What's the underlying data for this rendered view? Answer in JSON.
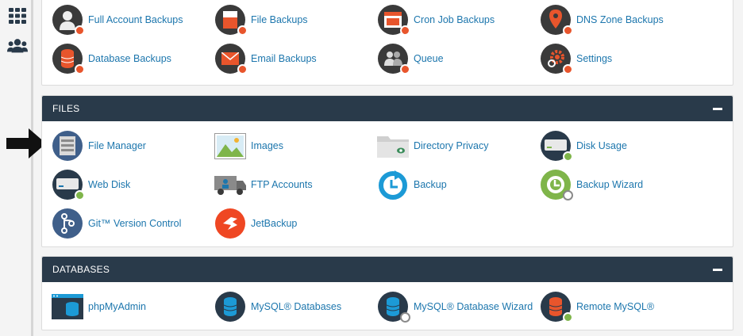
{
  "sidebar": {
    "icons": [
      "grid-icon",
      "users-icon"
    ]
  },
  "backups_panel": {
    "items": [
      {
        "label": "Full Account Backups",
        "icon": "full-backup-icon"
      },
      {
        "label": "File Backups",
        "icon": "file-backup-icon"
      },
      {
        "label": "Cron Job Backups",
        "icon": "cron-backup-icon"
      },
      {
        "label": "DNS Zone Backups",
        "icon": "dns-backup-icon"
      },
      {
        "label": "Database Backups",
        "icon": "database-backup-icon"
      },
      {
        "label": "Email Backups",
        "icon": "email-backup-icon"
      },
      {
        "label": "Queue",
        "icon": "queue-icon"
      },
      {
        "label": "Settings",
        "icon": "settings-icon"
      }
    ]
  },
  "files_panel": {
    "title": "FILES",
    "items": [
      {
        "label": "File Manager",
        "icon": "file-manager-icon"
      },
      {
        "label": "Images",
        "icon": "images-icon"
      },
      {
        "label": "Directory Privacy",
        "icon": "directory-privacy-icon"
      },
      {
        "label": "Disk Usage",
        "icon": "disk-usage-icon"
      },
      {
        "label": "Web Disk",
        "icon": "web-disk-icon"
      },
      {
        "label": "FTP Accounts",
        "icon": "ftp-accounts-icon"
      },
      {
        "label": "Backup",
        "icon": "backup-icon"
      },
      {
        "label": "Backup Wizard",
        "icon": "backup-wizard-icon"
      },
      {
        "label": "Git™ Version Control",
        "icon": "git-icon"
      },
      {
        "label": "JetBackup",
        "icon": "jetbackup-icon"
      }
    ]
  },
  "databases_panel": {
    "title": "DATABASES",
    "items": [
      {
        "label": "phpMyAdmin",
        "icon": "phpmyadmin-icon"
      },
      {
        "label": "MySQL® Databases",
        "icon": "mysql-databases-icon"
      },
      {
        "label": "MySQL® Database Wizard",
        "icon": "mysql-wizard-icon"
      },
      {
        "label": "Remote MySQL®",
        "icon": "remote-mysql-icon"
      }
    ]
  },
  "colors": {
    "header_bg": "#293a4a",
    "link": "#1c76ad",
    "accent_orange": "#e8552c",
    "arrow": "#111111"
  }
}
